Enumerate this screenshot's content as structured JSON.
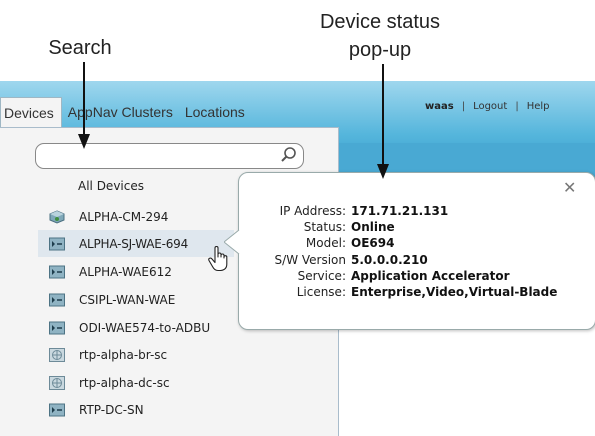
{
  "callouts": {
    "search": "Search",
    "device_status_line1": "Device status",
    "device_status_line2": "pop-up"
  },
  "header": {
    "user": "waas",
    "logout": "Logout",
    "help": "Help",
    "separator": "|"
  },
  "tabs": [
    {
      "label": "Devices",
      "active": true
    },
    {
      "label": "AppNav Clusters",
      "active": false
    },
    {
      "label": "Locations",
      "active": false
    }
  ],
  "search": {
    "value": "",
    "placeholder": ""
  },
  "device_list": {
    "all_label": "All Devices",
    "items": [
      {
        "label": "ALPHA-CM-294",
        "icon": "central-manager-icon"
      },
      {
        "label": "ALPHA-SJ-WAE-694",
        "icon": "wae-device-icon",
        "selected": true
      },
      {
        "label": "ALPHA-WAE612",
        "icon": "wae-device-icon"
      },
      {
        "label": "CSIPL-WAN-WAE",
        "icon": "wae-device-icon"
      },
      {
        "label": "ODI-WAE574-to-ADBU",
        "icon": "wae-device-icon"
      },
      {
        "label": "rtp-alpha-br-sc",
        "icon": "service-controller-icon"
      },
      {
        "label": "rtp-alpha-dc-sc",
        "icon": "service-controller-icon"
      },
      {
        "label": "RTP-DC-SN",
        "icon": "wae-device-icon"
      }
    ]
  },
  "popup": {
    "close": "✕",
    "rows": [
      {
        "label": "IP Address:",
        "value": "171.71.21.131"
      },
      {
        "label": "Status:",
        "value": "Online"
      },
      {
        "label": "Model:",
        "value": "OE694"
      },
      {
        "label": "S/W Version",
        "value": "5.0.0.0.210"
      },
      {
        "label": "Service:",
        "value": "Application Accelerator"
      },
      {
        "label": "License:",
        "value": "Enterprise,Video,Virtual-Blade"
      }
    ]
  }
}
